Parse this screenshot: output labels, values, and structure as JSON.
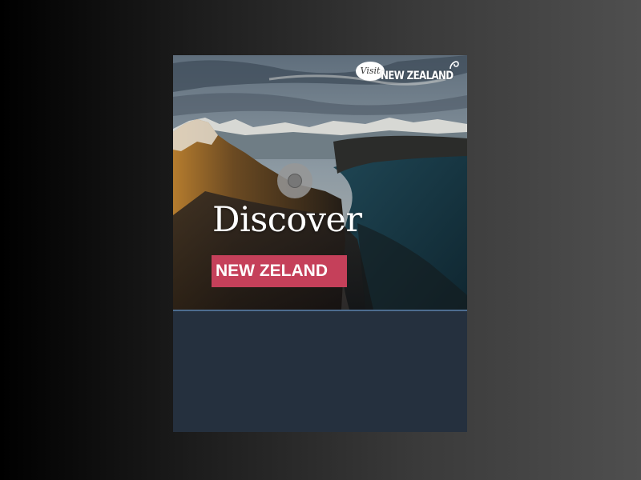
{
  "logo": {
    "visit_text": "Visit",
    "brand_text": "NEW ZEALAND",
    "icon": "fern-icon"
  },
  "hero": {
    "headline": "Discover",
    "cta_label": "NEW ZELAND",
    "play_icon": "play-circle-icon"
  },
  "colors": {
    "page_bg_left": "#000000",
    "page_bg_right": "#4f4f4f",
    "card_bg": "#25303e",
    "cta_bg": "#c5405a",
    "divider": "#4d6c8f"
  }
}
